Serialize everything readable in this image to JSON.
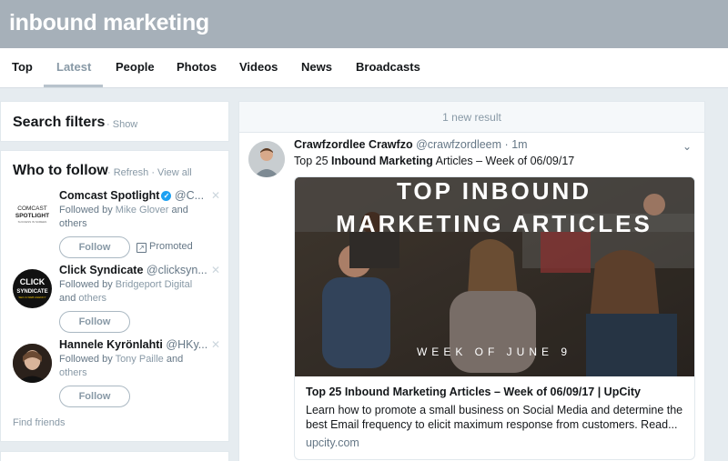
{
  "search": {
    "query": "inbound marketing"
  },
  "tabs": [
    {
      "label": "Top"
    },
    {
      "label": "Latest"
    },
    {
      "label": "People"
    },
    {
      "label": "Photos"
    },
    {
      "label": "Videos"
    },
    {
      "label": "News"
    },
    {
      "label": "Broadcasts"
    }
  ],
  "active_tab": "Latest",
  "search_filters": {
    "title": "Search filters",
    "show_label": "Show"
  },
  "who_to_follow": {
    "title": "Who to follow",
    "refresh_label": "Refresh",
    "view_all_label": "View all",
    "accounts": [
      {
        "name": "Comcast Spotlight",
        "handle": "@C...",
        "verified": true,
        "followed_prefix": "Followed by",
        "followed_by": "Mike Glover",
        "followed_suffix": "and others",
        "follow_label": "Follow",
        "promoted_label": "Promoted",
        "avatar_text_1": "COMCAST",
        "avatar_text_2": "SPOTLIGHT",
        "avatar_text_3": "SUCCESS IN SCREEN"
      },
      {
        "name": "Click Syndicate",
        "handle": "@clicksyn...",
        "followed_prefix": "Followed by",
        "followed_by": "Bridgeport Digital",
        "followed_suffix": "and",
        "followed_others": "others",
        "follow_label": "Follow",
        "avatar_text_1": "CLICK",
        "avatar_text_2": "SYNDICATE",
        "avatar_text_3": "SEO & WEB AGENCY"
      },
      {
        "name": "Hannele Kyrönlahti",
        "handle": "@HKy...",
        "followed_prefix": "Followed by",
        "followed_by": "Tony Paille",
        "followed_suffix": "and",
        "followed_others": "others",
        "follow_label": "Follow"
      }
    ],
    "find_friends_label": "Find friends"
  },
  "timeline": {
    "new_results_label": "1 new result",
    "tweet": {
      "author": "Crawfzordlee Crawfzo",
      "handle": "@crawfzordleem",
      "separator": "·",
      "time": "1m",
      "text_prefix": "Top 25",
      "text_bold": "Inbound Marketing",
      "text_suffix": "Articles – Week of 06/09/17",
      "card": {
        "image_line_1": "TOP INBOUND",
        "image_line_2": "MARKETING ARTICLES",
        "image_line_3": "WEEK OF JUNE 9",
        "title": "Top 25 Inbound Marketing Articles – Week of 06/09/17 | UpCity",
        "description": "Learn how to promote a small business on Social Media and determine the best Email frequency to elicit maximum response from customers. Read...",
        "domain": "upcity.com"
      }
    }
  },
  "colors": {
    "header_bg": "#a6b0b9",
    "page_bg": "#e6ecf0",
    "link_blue": "#1da1f2",
    "muted_text": "#8899a6"
  },
  "icons": [
    "verified-icon",
    "close-icon",
    "promoted-icon",
    "chevron-down-icon"
  ]
}
